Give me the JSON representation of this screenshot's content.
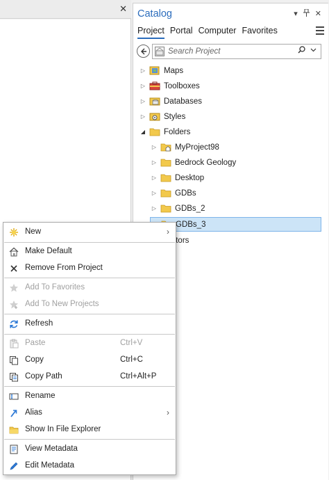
{
  "left_pane": {
    "close_glyph": "✕"
  },
  "catalog": {
    "title": "Catalog",
    "title_icons": [
      "▾",
      "🖈",
      "✕"
    ],
    "tabs": [
      "Project",
      "Portal",
      "Computer",
      "Favorites"
    ],
    "search_placeholder": "Search Project",
    "tree": [
      {
        "label": "Maps",
        "expanded": false,
        "level": 0,
        "icon": "maps-icon"
      },
      {
        "label": "Toolboxes",
        "expanded": false,
        "level": 0,
        "icon": "toolbox-icon"
      },
      {
        "label": "Databases",
        "expanded": false,
        "level": 0,
        "icon": "database-icon"
      },
      {
        "label": "Styles",
        "expanded": false,
        "level": 0,
        "icon": "styles-icon"
      },
      {
        "label": "Folders",
        "expanded": true,
        "level": 0,
        "icon": "folder-icon"
      },
      {
        "label": "MyProject98",
        "expanded": false,
        "level": 1,
        "icon": "home-folder-icon"
      },
      {
        "label": "Bedrock Geology",
        "expanded": false,
        "level": 1,
        "icon": "folder-icon"
      },
      {
        "label": "Desktop",
        "expanded": false,
        "level": 1,
        "icon": "folder-icon"
      },
      {
        "label": "GDBs",
        "expanded": false,
        "level": 1,
        "icon": "folder-icon"
      },
      {
        "label": "GDBs_2",
        "expanded": false,
        "level": 1,
        "icon": "folder-icon"
      },
      {
        "label": "GDBs_3",
        "expanded": false,
        "level": 1,
        "icon": "folder-icon",
        "selected": true
      },
      {
        "label": "rators",
        "expanded": false,
        "level": 0,
        "icon": ""
      }
    ]
  },
  "context_menu": {
    "items": [
      {
        "label": "New",
        "icon": "new-icon",
        "submenu": true,
        "disabled": false
      },
      {
        "separator": true
      },
      {
        "label": "Make Default",
        "icon": "home-icon",
        "disabled": false
      },
      {
        "label": "Remove From Project",
        "icon": "x-icon",
        "disabled": false
      },
      {
        "separator": true
      },
      {
        "label": "Add To Favorites",
        "icon": "star-icon",
        "disabled": true
      },
      {
        "label": "Add To New Projects",
        "icon": "star-plus-icon",
        "disabled": true
      },
      {
        "separator": true
      },
      {
        "label": "Refresh",
        "icon": "refresh-icon",
        "disabled": false
      },
      {
        "separator": true
      },
      {
        "label": "Paste",
        "icon": "paste-icon",
        "shortcut": "Ctrl+V",
        "disabled": true
      },
      {
        "label": "Copy",
        "icon": "copy-icon",
        "shortcut": "Ctrl+C",
        "disabled": false
      },
      {
        "label": "Copy Path",
        "icon": "copy-path-icon",
        "shortcut": "Ctrl+Alt+P",
        "disabled": false
      },
      {
        "separator": true
      },
      {
        "label": "Rename",
        "icon": "rename-icon",
        "disabled": false
      },
      {
        "label": "Alias",
        "icon": "alias-icon",
        "submenu": true,
        "disabled": false
      },
      {
        "label": "Show In File Explorer",
        "icon": "file-explorer-icon",
        "disabled": false
      },
      {
        "separator": true
      },
      {
        "label": "View Metadata",
        "icon": "view-metadata-icon",
        "disabled": false
      },
      {
        "label": "Edit Metadata",
        "icon": "edit-metadata-icon",
        "disabled": false
      }
    ]
  },
  "colors": {
    "accent": "#2b6cbc",
    "selection_bg": "#cce4f7",
    "selection_border": "#7eb4ea",
    "folder": "#f2c94c",
    "disabled_text": "#a0a0a0"
  }
}
